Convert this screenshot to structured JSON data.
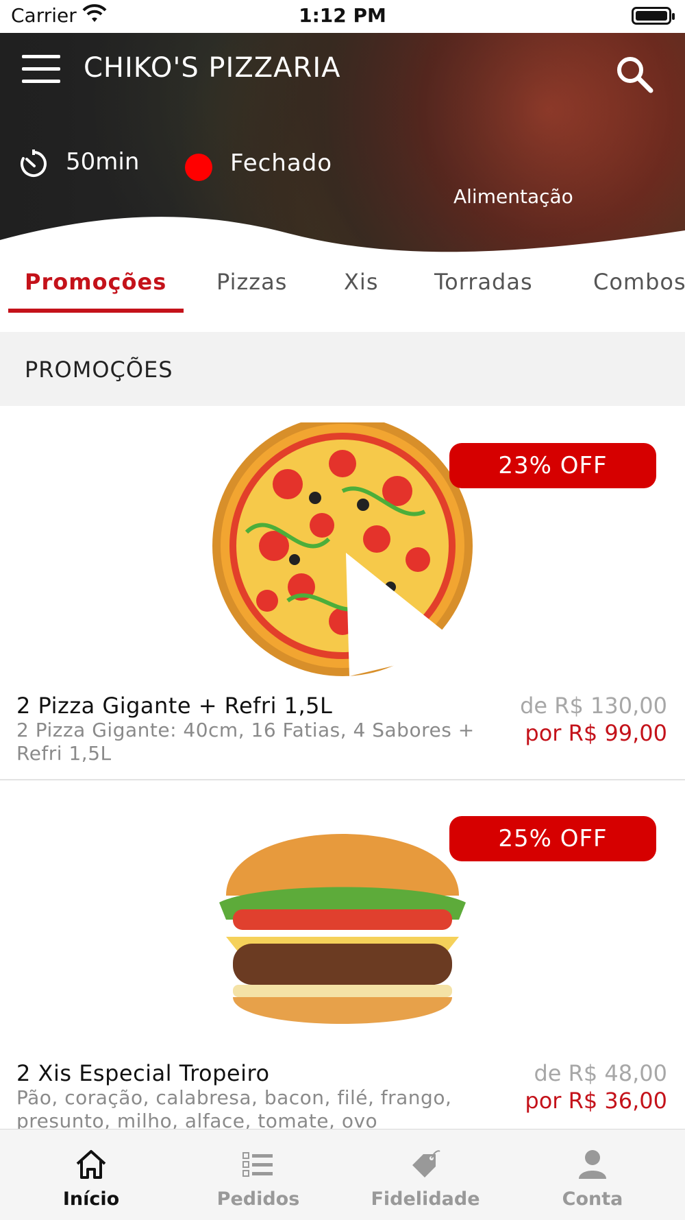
{
  "status_bar": {
    "carrier": "Carrier",
    "time": "1:12 PM"
  },
  "header": {
    "title": "CHIKO'S PIZZARIA",
    "delivery_time": "50min",
    "store_status": "Fechado",
    "store_status_color": "#ff0000",
    "category": "Alimentação",
    "icons": [
      "menu-icon",
      "search-icon",
      "timer-icon"
    ]
  },
  "tabs": [
    {
      "label": "Promoções",
      "active": true
    },
    {
      "label": "Pizzas",
      "active": false
    },
    {
      "label": "Xis",
      "active": false
    },
    {
      "label": "Torradas",
      "active": false
    },
    {
      "label": "Combos",
      "active": false
    }
  ],
  "section": {
    "title": "PROMOÇÕES"
  },
  "items": [
    {
      "discount": "23% OFF",
      "name": "2 Pizza Gigante + Refri 1,5L",
      "description": "2 Pizza Gigante: 40cm, 16 Fatias, 4 Sabores + Refri 1,5L",
      "price_old": "de R$ 130,00",
      "price_new": "por R$ 99,00",
      "image": "pizza-image"
    },
    {
      "discount": "25% OFF",
      "name": "2 Xis Especial Tropeiro",
      "description": "Pão, coração, calabresa, bacon, filé, frango, presunto, milho, alface, tomate, ovo",
      "price_old": "de R$ 48,00",
      "price_new": "por R$ 36,00",
      "image": "burger-image"
    }
  ],
  "bottom_nav": [
    {
      "label": "Início",
      "icon": "home-icon",
      "active": true
    },
    {
      "label": "Pedidos",
      "icon": "list-icon",
      "active": false
    },
    {
      "label": "Fidelidade",
      "icon": "tag-icon",
      "active": false
    },
    {
      "label": "Conta",
      "icon": "user-icon",
      "active": false
    }
  ],
  "colors": {
    "accent": "#c4121a",
    "badge": "#d60000"
  }
}
